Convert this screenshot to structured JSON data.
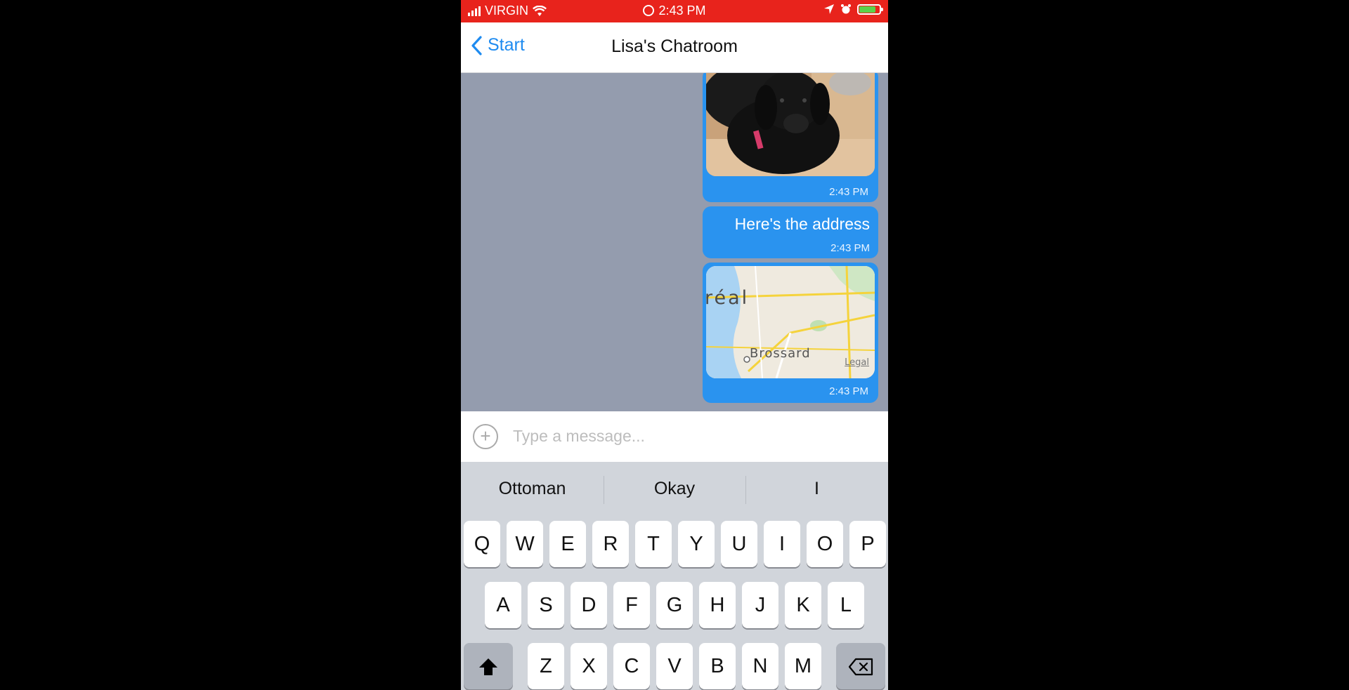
{
  "status_bar": {
    "carrier": "VIRGIN",
    "time": "2:43 PM"
  },
  "nav": {
    "back_label": "Start",
    "title": "Lisa's Chatroom"
  },
  "messages": [
    {
      "type": "image",
      "time": "2:43 PM"
    },
    {
      "type": "text",
      "text": "Here's the address",
      "time": "2:43 PM"
    },
    {
      "type": "map",
      "map_city": "réal",
      "map_town": "Brossard",
      "map_legal": "Legal",
      "time": "2:43 PM"
    }
  ],
  "input": {
    "placeholder": "Type a message..."
  },
  "keyboard": {
    "suggestions": [
      "Ottoman",
      "Okay",
      "I"
    ],
    "row1": [
      "Q",
      "W",
      "E",
      "R",
      "T",
      "Y",
      "U",
      "I",
      "O",
      "P"
    ],
    "row2": [
      "A",
      "S",
      "D",
      "F",
      "G",
      "H",
      "J",
      "K",
      "L"
    ],
    "row3": [
      "Z",
      "X",
      "C",
      "V",
      "B",
      "N",
      "M"
    ]
  },
  "colors": {
    "status_bar": "#e8231c",
    "accent": "#1e8bf0",
    "bubble": "#2a93ef",
    "chat_background": "#949cae"
  }
}
